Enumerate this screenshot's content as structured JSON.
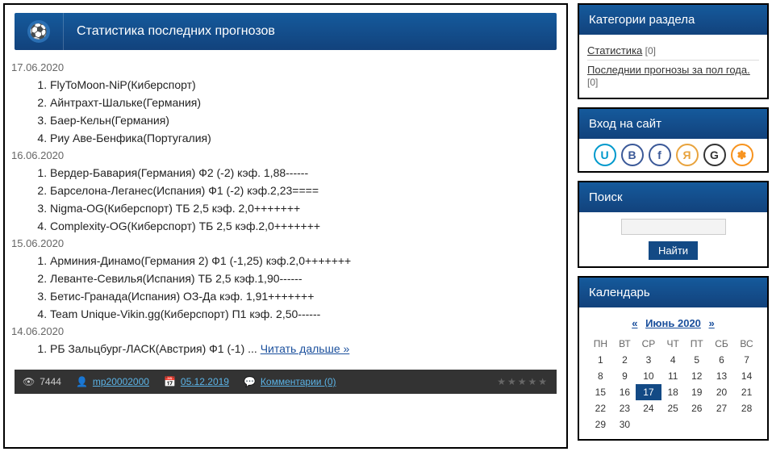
{
  "title": "Статистика последних прогнозов",
  "groups": [
    {
      "date": "17.06.2020",
      "items": [
        "FlyToMoon-NiP(Киберспорт)",
        "Айнтрахт-Шальке(Германия)",
        "Баер-Кельн(Германия)",
        "Риу Аве-Бенфика(Португалия)"
      ]
    },
    {
      "date": "16.06.2020",
      "items": [
        "Вердер-Бавария(Германия) Ф2 (-2) кэф. 1,88------",
        "Барселона-Леганес(Испания) Ф1 (-2) кэф.2,23====",
        "Nigma-OG(Киберспорт) ТБ 2,5 кэф. 2,0+++++++",
        "Complexity-OG(Киберспорт) ТБ 2,5 кэф.2,0+++++++"
      ]
    },
    {
      "date": "15.06.2020",
      "items": [
        "Арминия-Динамо(Германия 2) Ф1 (-1,25) кэф.2,0+++++++",
        "Леванте-Севилья(Испания) ТБ 2,5 кэф.1,90------",
        "Бетис-Гранада(Испания) ОЗ-Да кэф. 1,91+++++++",
        "Team Unique-Vikin.gg(Киберспорт) П1 кэф. 2,50------"
      ]
    },
    {
      "date": "14.06.2020",
      "items": []
    }
  ],
  "last_line_prefix": "РБ Зальцбург-ЛАСК(Австрия) Ф1 (-1) ... ",
  "read_more": "Читать дальше »",
  "meta": {
    "views": "7444",
    "author": "mp20002000",
    "date": "05.12.2019",
    "comments": "Комментарии (0)"
  },
  "sidebar": {
    "categories": {
      "header": "Категории раздела",
      "items": [
        {
          "label": "Статистика",
          "count": "[0]"
        },
        {
          "label": "Последнии прогнозы за пол года.",
          "count": "[0]"
        }
      ]
    },
    "login": {
      "header": "Вход на сайт"
    },
    "search": {
      "header": "Поиск",
      "button": "Найти"
    },
    "calendar": {
      "header": "Календарь",
      "prev": "«",
      "next": "»",
      "month": "Июнь 2020",
      "dow": [
        "ПН",
        "ВТ",
        "СР",
        "ЧТ",
        "ПТ",
        "СБ",
        "ВС"
      ],
      "weeks": [
        [
          1,
          2,
          3,
          4,
          5,
          6,
          7
        ],
        [
          8,
          9,
          10,
          11,
          12,
          13,
          14
        ],
        [
          15,
          16,
          17,
          18,
          19,
          20,
          21
        ],
        [
          22,
          23,
          24,
          25,
          26,
          27,
          28
        ],
        [
          29,
          30,
          null,
          null,
          null,
          null,
          null
        ]
      ],
      "today": 17
    }
  }
}
